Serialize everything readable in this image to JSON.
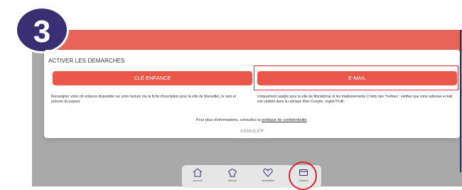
{
  "step": {
    "number": "3"
  },
  "modal": {
    "title": "ACTIVER LES DEMARCHES",
    "buttons": {
      "cle": "CLÉ ENFANCE",
      "email": "E-MAIL"
    },
    "desc_left": "Renseigner votre clé enfance disponible sur votre facture (ou la fiche d'inscription pour la ville de Marseille), le nom et prénom du payeur.",
    "desc_right": "Uniquement valable pour la ville de Montélimar et les établissements C'midy des Yvelines : vérifiez que votre adresse e-mail soit validée dans la rubrique Mon Compte, onglet Profil.",
    "info_prefix": "Pour plus d'informations, consultez la ",
    "info_link": "politique de confidentialité",
    "info_suffix": ".",
    "cancel": "ANNULER"
  },
  "nav": {
    "items": [
      {
        "label": "Accueil",
        "icon": "home-icon"
      },
      {
        "label": "Menus",
        "icon": "chef-hat-icon"
      },
      {
        "label": "Actualités",
        "icon": "heart-icon"
      },
      {
        "label": "Cantine",
        "icon": "card-icon"
      }
    ]
  },
  "colors": {
    "accent": "#e8574a",
    "badge": "#3b2f73",
    "highlight": "#d8262c"
  }
}
